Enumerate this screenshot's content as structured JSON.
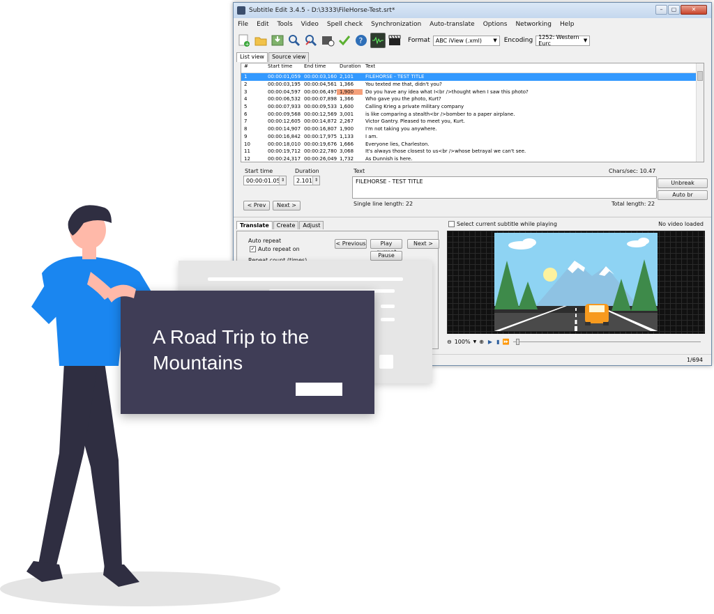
{
  "window": {
    "title": "Subtitle Edit 3.4.5 - D:\\3333\\FileHorse-Test.srt*",
    "controls": [
      "–",
      "▢",
      "✕"
    ]
  },
  "menu": [
    "File",
    "Edit",
    "Tools",
    "Video",
    "Spell check",
    "Synchronization",
    "Auto-translate",
    "Options",
    "Networking",
    "Help"
  ],
  "toolbar": {
    "format_label": "Format",
    "format_value": "ABC iView (.xml)",
    "encoding_label": "Encoding",
    "encoding_value": "1252: Western Eurc"
  },
  "view_tabs": [
    "List view",
    "Source view"
  ],
  "list": {
    "columns": [
      "#",
      "Start time",
      "End time",
      "Duration",
      "Text"
    ],
    "rows": [
      [
        "1",
        "00:00:01,059",
        "00:00:03,160",
        "2,101",
        "FILEHORSE - TEST TITLE"
      ],
      [
        "2",
        "00:00:03,195",
        "00:00:04,561",
        "1,366",
        "You texted me that, didn't you?"
      ],
      [
        "3",
        "00:00:04,597",
        "00:00:06,497",
        "1,900",
        "Do you have any idea what I<br />thought when I saw this photo?"
      ],
      [
        "4",
        "00:00:06,532",
        "00:00:07,898",
        "1,366",
        "Who gave you the photo, Kurt?"
      ],
      [
        "5",
        "00:00:07,933",
        "00:00:09,533",
        "1,600",
        "Calling Krieg a private military company"
      ],
      [
        "6",
        "00:00:09,568",
        "00:00:12,569",
        "3,001",
        "is like comparing a stealth<br />bomber to a paper airplane."
      ],
      [
        "7",
        "00:00:12,605",
        "00:00:14,872",
        "2,267",
        "Victor Gantry. Pleased to meet you, Kurt."
      ],
      [
        "8",
        "00:00:14,907",
        "00:00:16,807",
        "1,900",
        "I'm not taking you anywhere."
      ],
      [
        "9",
        "00:00:16,842",
        "00:00:17,975",
        "1,133",
        "I am."
      ],
      [
        "10",
        "00:00:18,010",
        "00:00:19,676",
        "1,666",
        "Everyone lies, Charleston."
      ],
      [
        "11",
        "00:00:19,712",
        "00:00:22,780",
        "3,068",
        "It's always those closest to us<br />whose betrayal we can't see."
      ],
      [
        "12",
        "00:00:24,317",
        "00:00:26,049",
        "1,732",
        "As Dunnish is here."
      ]
    ]
  },
  "edit": {
    "start_time_label": "Start time",
    "start_time_value": "00:00:01.059",
    "duration_label": "Duration",
    "duration_value": "2.101",
    "text_label": "Text",
    "text_value": "FILEHORSE - TEST TITLE",
    "chars_sec": "Chars/sec: 10.47",
    "unbreak": "Unbreak",
    "auto_br": "Auto br",
    "prev": "< Prev",
    "next": "Next >",
    "single_line_length": "Single line length: 22",
    "total_length": "Total length: 22"
  },
  "bottom_tabs": [
    "Translate",
    "Create",
    "Adjust"
  ],
  "translate": {
    "auto_repeat_group": "Auto repeat",
    "auto_repeat_on": "Auto repeat on",
    "repeat_count": "Repeat count (times)",
    "previous": "< Previous",
    "play_current": "Play current",
    "next": "Next >",
    "pause": "Pause"
  },
  "video": {
    "select_current": "Select current subtitle while playing",
    "no_video": "No video loaded",
    "zoom": "100%"
  },
  "status": {
    "position": "1/694"
  },
  "card": {
    "title": "A Road Trip to the Mountains"
  }
}
